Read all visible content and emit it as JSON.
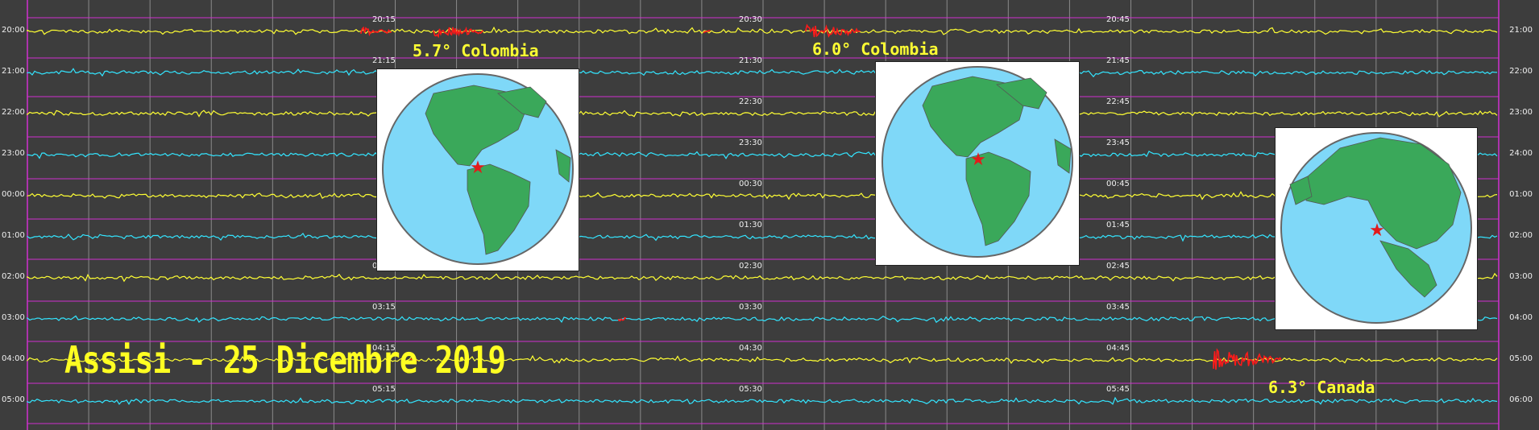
{
  "title": "Assisi - 25 Dicembre 2019",
  "left_hour_labels": [
    "20:00",
    "21:00",
    "22:00",
    "23:00",
    "00:00",
    "01:00",
    "02:00",
    "03:00",
    "04:00",
    "05:00"
  ],
  "right_hour_labels": [
    "21:00",
    "22:00",
    "23:00",
    "24:00",
    "01:00",
    "02:00",
    "03:00",
    "04:00",
    "05:00",
    "06:00"
  ],
  "minute_labels": [
    [
      "20:15",
      "20:30",
      "20:45"
    ],
    [
      "21:15",
      "21:30",
      "21:45"
    ],
    [
      "",
      "22:30",
      "22:45"
    ],
    [
      "",
      "23:30",
      "23:45"
    ],
    [
      "",
      "00:30",
      "00:45"
    ],
    [
      "",
      "01:30",
      "01:45"
    ],
    [
      "02:15",
      "02:30",
      "02:45"
    ],
    [
      "03:15",
      "03:30",
      "03:45"
    ],
    [
      "04:15",
      "04:30",
      "04:45"
    ],
    [
      "05:15",
      "05:30",
      "05:45"
    ]
  ],
  "earthquakes": [
    {
      "label": "5.7° Colombia"
    },
    {
      "label": "6.0° Colombia"
    },
    {
      "label": "6.3° Canada"
    }
  ],
  "colors": {
    "background": "#3d3d3d",
    "trace_yellow": "#ffff33",
    "trace_cyan": "#33e5ff",
    "separator": "#d030d0",
    "grid": "#8a8a8a",
    "event": "#ff1a1a",
    "ocean": "#7fd8f8",
    "land": "#3aa85a"
  }
}
